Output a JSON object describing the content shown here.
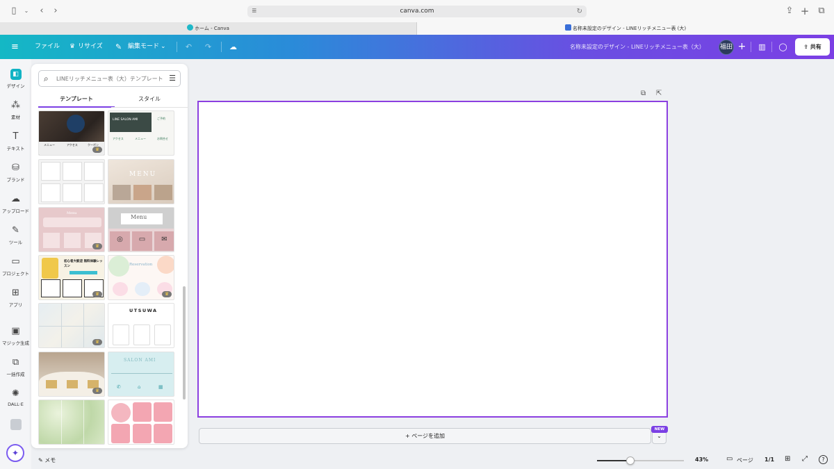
{
  "browser": {
    "url": "canva.com",
    "tabs": [
      {
        "title": "ホーム - Canva"
      },
      {
        "title": "名称未設定のデザイン - LINEリッチメニュー表 (大)"
      }
    ]
  },
  "header": {
    "file_label": "ファイル",
    "resize_label": "リサイズ",
    "edit_mode_label": "編集モード",
    "doc_title": "名称未設定のデザイン - LINEリッチメニュー表（大）",
    "avatar_label": "福田",
    "share_label": "共有"
  },
  "rail": {
    "items": [
      {
        "label": "デザイン",
        "icon": "design-icon"
      },
      {
        "label": "素材",
        "icon": "elements-icon"
      },
      {
        "label": "テキスト",
        "icon": "text-icon"
      },
      {
        "label": "ブランド",
        "icon": "brand-icon"
      },
      {
        "label": "アップロード",
        "icon": "upload-icon"
      },
      {
        "label": "ツール",
        "icon": "tools-icon"
      },
      {
        "label": "プロジェクト",
        "icon": "folder-icon"
      },
      {
        "label": "アプリ",
        "icon": "apps-icon"
      },
      {
        "label": "マジック生成",
        "icon": "magic-media-icon"
      },
      {
        "label": "一括作成",
        "icon": "bulk-create-icon"
      },
      {
        "label": "DALL·E",
        "icon": "dalle-icon"
      }
    ]
  },
  "panel": {
    "search_placeholder": "LINEリッチメニュー表（大）テンプレート",
    "tabs": [
      {
        "label": "テンプレート"
      },
      {
        "label": "スタイル"
      }
    ],
    "templates": [
      {
        "caption": "",
        "sub": "",
        "tiles": [
          "メニュー",
          "アクセス",
          "クーポン"
        ]
      },
      {
        "caption": "LINE SALON AMI",
        "sub": "",
        "tiles": [
          "ご予約",
          "アクセス",
          "メニュー",
          "お問合せ"
        ]
      },
      {
        "caption": "",
        "sub": "",
        "tiles": [
          "",
          "",
          "",
          "",
          "",
          ""
        ]
      },
      {
        "caption": "MENU",
        "sub": "",
        "tiles": []
      },
      {
        "caption": "Menu",
        "sub": "",
        "tiles": []
      },
      {
        "caption": "Menu",
        "sub": "",
        "tiles": []
      },
      {
        "caption": "初心者大歓迎 無料体験レッスン",
        "sub": "",
        "tiles": []
      },
      {
        "caption": "Reservation",
        "sub": "",
        "tiles": []
      },
      {
        "caption": "",
        "sub": "",
        "tiles": []
      },
      {
        "caption": "UTSUWA",
        "sub": "",
        "tiles": []
      },
      {
        "caption": "",
        "sub": "",
        "tiles": []
      },
      {
        "caption": "SALON AMI",
        "sub": "",
        "tiles": []
      },
      {
        "caption": "",
        "sub": "",
        "tiles": []
      },
      {
        "caption": "",
        "sub": "",
        "tiles": []
      }
    ]
  },
  "canvas": {
    "add_page_label": "+ ページを追加",
    "new_badge": "NEW"
  },
  "bottom": {
    "memo_label": "メモ",
    "zoom": "43%",
    "zoom_slider_fraction": 0.38,
    "pages_label": "ページ",
    "page_count": "1/1"
  },
  "colors": {
    "brand_teal": "#11b3c4",
    "brand_purple": "#7b3fe4"
  }
}
